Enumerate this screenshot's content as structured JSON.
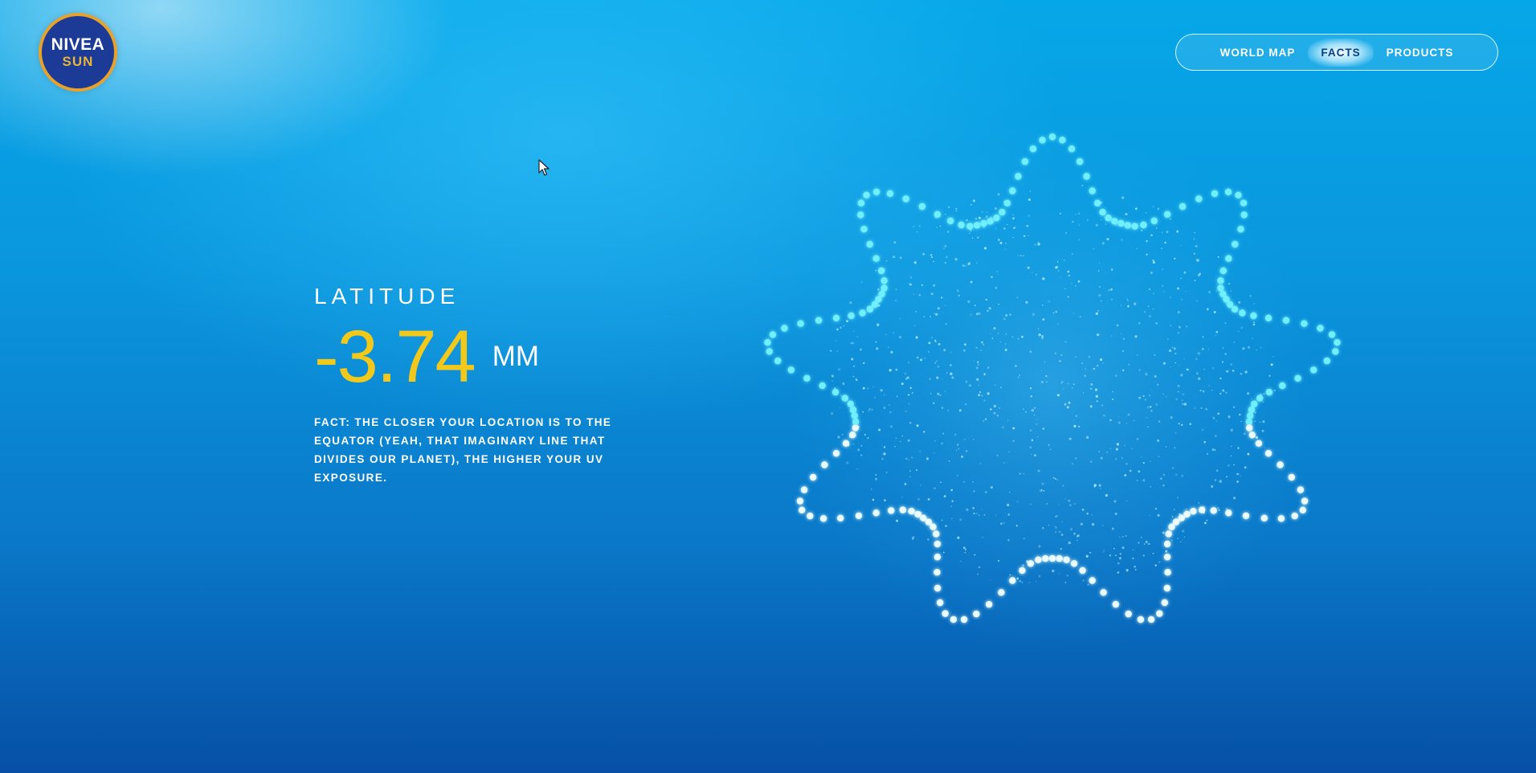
{
  "logo": {
    "brand": "NIVEA",
    "sub": "SUN"
  },
  "nav": {
    "items": [
      {
        "label": "WORLD MAP"
      },
      {
        "label": "FACTS"
      },
      {
        "label": "PRODUCTS"
      }
    ],
    "active": "FACTS"
  },
  "fact": {
    "label": "LATITUDE",
    "value": "-3.74",
    "unit": "MM",
    "text": "FACT: THE CLOSER YOUR LOCATION IS TO THE EQUATOR (YEAH, THAT IMAGINARY LINE THAT DIVIDES OUR PLANET), THE HIGHER YOUR UV EXPOSURE."
  },
  "colors": {
    "accent_yellow": "#f2c81a",
    "logo_blue": "#1b3b96",
    "logo_gold": "#e8a12a",
    "dot_cyan": "#5fe3ff",
    "background_blue": "#0a96dd"
  },
  "icons": {
    "cursor": "arrow-cursor-icon",
    "visual": "sun-dots-icon"
  }
}
